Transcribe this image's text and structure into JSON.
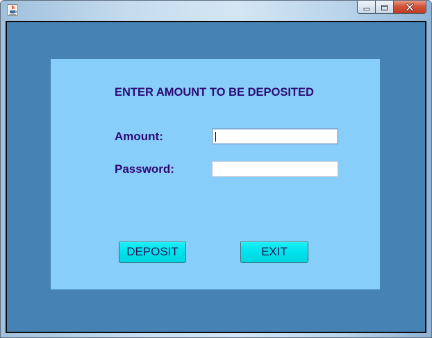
{
  "window": {
    "title": "",
    "controls": {
      "minimize_icon": "minimize-icon",
      "maximize_icon": "maximize-icon",
      "close_icon": "close-icon"
    }
  },
  "form": {
    "heading": "ENTER AMOUNT TO BE DEPOSITED",
    "amount_label": "Amount:",
    "amount_value": "",
    "password_label": "Password:",
    "password_value": ""
  },
  "buttons": {
    "deposit_label": "DEPOSIT",
    "exit_label": "EXIT"
  },
  "colors": {
    "outer_background": "#4682b4",
    "panel_background": "#87cefa",
    "text": "#2e0a74",
    "button": "#00e2ec"
  }
}
